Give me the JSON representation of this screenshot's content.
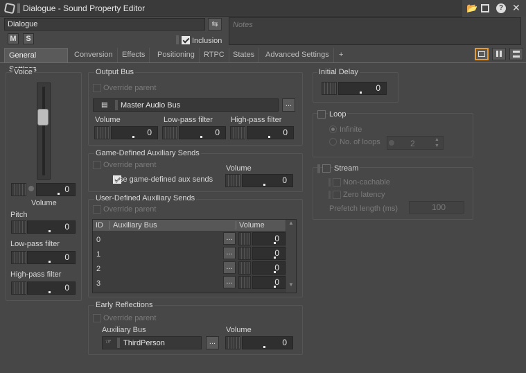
{
  "window": {
    "title": "Dialogue - Sound Property Editor"
  },
  "object": {
    "name": "Dialogue",
    "mute_label": "M",
    "solo_label": "S",
    "inclusion_label": "Inclusion",
    "notes_placeholder": "Notes"
  },
  "tabs": [
    "General Settings",
    "Conversion",
    "Effects",
    "Positioning",
    "RTPC",
    "States",
    "Advanced Settings",
    "+"
  ],
  "voice": {
    "title": "Voice",
    "volume_label": "Volume",
    "volume": "0",
    "pitch_label": "Pitch",
    "pitch": "0",
    "lowpass_label": "Low-pass filter",
    "lowpass": "0",
    "highpass_label": "High-pass filter",
    "highpass": "0"
  },
  "output_bus": {
    "title": "Output Bus",
    "override_label": "Override parent",
    "bus_name": "Master Audio Bus",
    "browse": "...",
    "volume_label": "Volume",
    "volume": "0",
    "lowpass_label": "Low-pass filter",
    "lowpass": "0",
    "highpass_label": "High-pass filter",
    "highpass": "0"
  },
  "game_aux": {
    "title": "Game-Defined Auxiliary Sends",
    "override_label": "Override parent",
    "use_label": "Use game-defined aux sends",
    "volume_label": "Volume",
    "volume": "0"
  },
  "user_aux": {
    "title": "User-Defined Auxiliary Sends",
    "override_label": "Override parent",
    "col_id": "ID",
    "col_bus": "Auxiliary Bus",
    "col_volume": "Volume",
    "browse": "...",
    "rows": [
      {
        "id": "0",
        "bus": "",
        "volume": "0"
      },
      {
        "id": "1",
        "bus": "",
        "volume": "0"
      },
      {
        "id": "2",
        "bus": "",
        "volume": "0"
      },
      {
        "id": "3",
        "bus": "",
        "volume": "0"
      }
    ]
  },
  "early_reflections": {
    "title": "Early Reflections",
    "override_label": "Override parent",
    "aux_label": "Auxiliary Bus",
    "bus_name": "ThirdPerson",
    "browse": "...",
    "volume_label": "Volume",
    "volume": "0"
  },
  "initial_delay": {
    "title": "Initial Delay",
    "value": "0"
  },
  "loop": {
    "title": "Loop",
    "infinite_label": "Infinite",
    "loops_label": "No. of loops",
    "loops_value": "2"
  },
  "stream": {
    "title": "Stream",
    "noncachable_label": "Non-cachable",
    "zerolatency_label": "Zero latency",
    "prefetch_label": "Prefetch length (ms)",
    "prefetch_value": "100"
  },
  "colors": {
    "accent": "#e39a3b",
    "background": "#474747"
  }
}
